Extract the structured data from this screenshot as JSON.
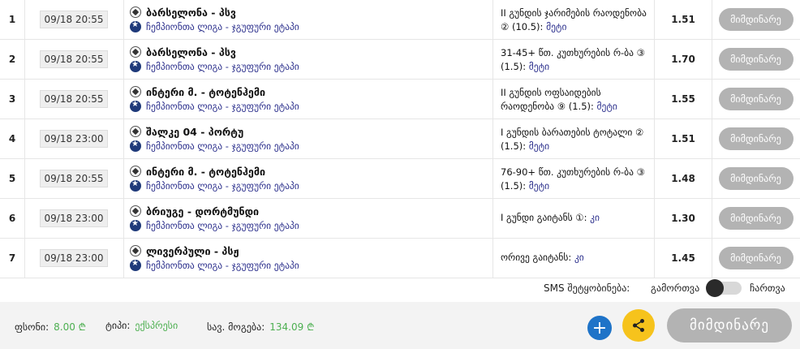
{
  "rows": [
    {
      "num": "1",
      "date": "09/18 20:55",
      "teams": "ბარსელონა - პსვ",
      "league": "ჩემპიონთა ლიგა - ჯგუფური ეტაპი",
      "bet_text": "II გუნდის ჯარიმების რაოდენობა ② (10.5):",
      "pick": "მეტი",
      "odd": "1.51",
      "status": "მიმდინარე"
    },
    {
      "num": "2",
      "date": "09/18 20:55",
      "teams": "ბარსელონა - პსვ",
      "league": "ჩემპიონთა ლიგა - ჯგუფური ეტაპი",
      "bet_text": "31-45+ წთ. კუთხურების რ-ბა ③ (1.5):",
      "pick": "მეტი",
      "odd": "1.70",
      "status": "მიმდინარე"
    },
    {
      "num": "3",
      "date": "09/18 20:55",
      "teams": "ინტერი მ. - ტოტენჰემი",
      "league": "ჩემპიონთა ლიგა - ჯგუფური ეტაპი",
      "bet_text": "II გუნდის ოფსაიდების რაოდენობა ⑨ (1.5):",
      "pick": "მეტი",
      "odd": "1.55",
      "status": "მიმდინარე"
    },
    {
      "num": "4",
      "date": "09/18 23:00",
      "teams": "შალკე 04 - პორტუ",
      "league": "ჩემპიონთა ლიგა - ჯგუფური ეტაპი",
      "bet_text": "I გუნდის ბარათების ტოტალი ② (1.5):",
      "pick": "მეტი",
      "odd": "1.51",
      "status": "მიმდინარე"
    },
    {
      "num": "5",
      "date": "09/18 20:55",
      "teams": "ინტერი მ. - ტოტენჰემი",
      "league": "ჩემპიონთა ლიგა - ჯგუფური ეტაპი",
      "bet_text": "76-90+ წთ. კუთხურების რ-ბა ③ (1.5):",
      "pick": "მეტი",
      "odd": "1.48",
      "status": "მიმდინარე"
    },
    {
      "num": "6",
      "date": "09/18 23:00",
      "teams": "ბრიუგე - დორტმუნდი",
      "league": "ჩემპიონთა ლიგა - ჯგუფური ეტაპი",
      "bet_text": "I გუნდი გაიტანს ①:",
      "pick": "კი",
      "odd": "1.30",
      "status": "მიმდინარე"
    },
    {
      "num": "7",
      "date": "09/18 23:00",
      "teams": "ლივერპული - პსჟ",
      "league": "ჩემპიონთა ლიგა - ჯგუფური ეტაპი",
      "bet_text": "ორივე გაიტანს:",
      "pick": "კი",
      "odd": "1.45",
      "status": "მიმდინარე"
    }
  ],
  "sms": {
    "label": "SMS შეტყობინება:",
    "off": "გამორთვა",
    "on": "ჩართვა"
  },
  "footer": {
    "stake_label": "ფსონი:",
    "stake_value": "8.00 ₾",
    "type_label": "ტიპი:",
    "type_value": "ექსპრესი",
    "win_label": "სავ. მოგება:",
    "win_value": "134.09 ₾",
    "status": "მიმდინარე"
  },
  "icons": {
    "plus": "plus-icon",
    "share": "share-icon",
    "ball": "soccer-ball-icon",
    "league": "champions-league-icon"
  },
  "colors": {
    "accent_green": "#4caf50",
    "status_grey": "#b3b3b3",
    "plus_blue": "#1e73c8",
    "share_yellow": "#f6c31c",
    "league_text": "#2b2f8c"
  }
}
